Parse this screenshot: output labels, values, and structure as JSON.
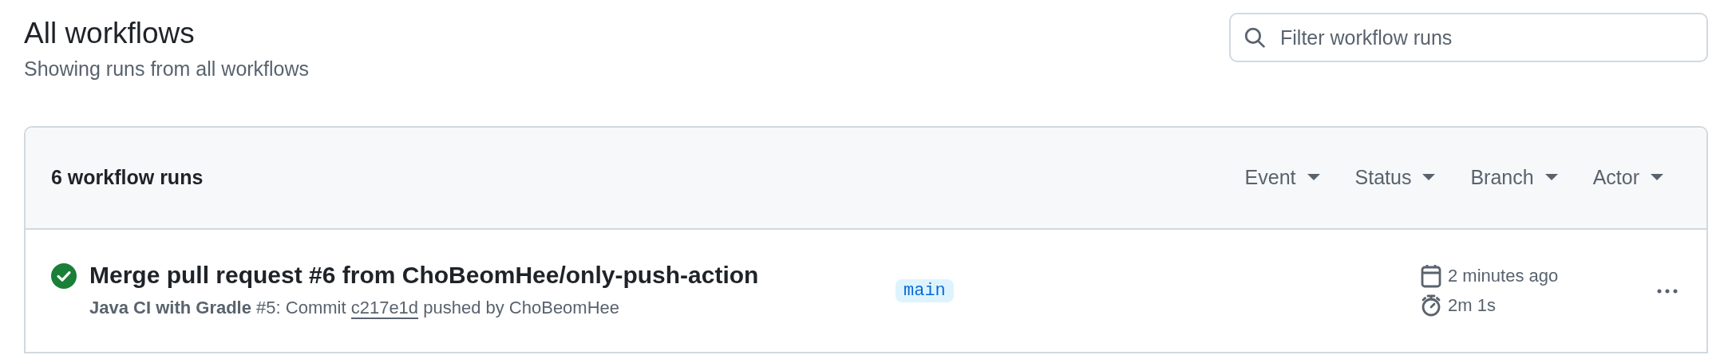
{
  "page": {
    "title": "All workflows",
    "subtitle": "Showing runs from all workflows"
  },
  "search": {
    "placeholder": "Filter workflow runs"
  },
  "runs_panel": {
    "count": "6 workflow runs",
    "filters": [
      {
        "label": "Event"
      },
      {
        "label": "Status"
      },
      {
        "label": "Branch"
      },
      {
        "label": "Actor"
      }
    ]
  },
  "runs": [
    {
      "kind": "success",
      "title": "Merge pull request #6 from ChoBeomHee/only-push-action",
      "meta_before": "**Java CI with Gradle** #5: Commit",
      "commit": "c217e1d",
      "meta_after": "pushed by ChoBeomHee",
      "branch": "main",
      "started": "2 minutes ago",
      "duration": "2m 1s"
    }
  ]
}
